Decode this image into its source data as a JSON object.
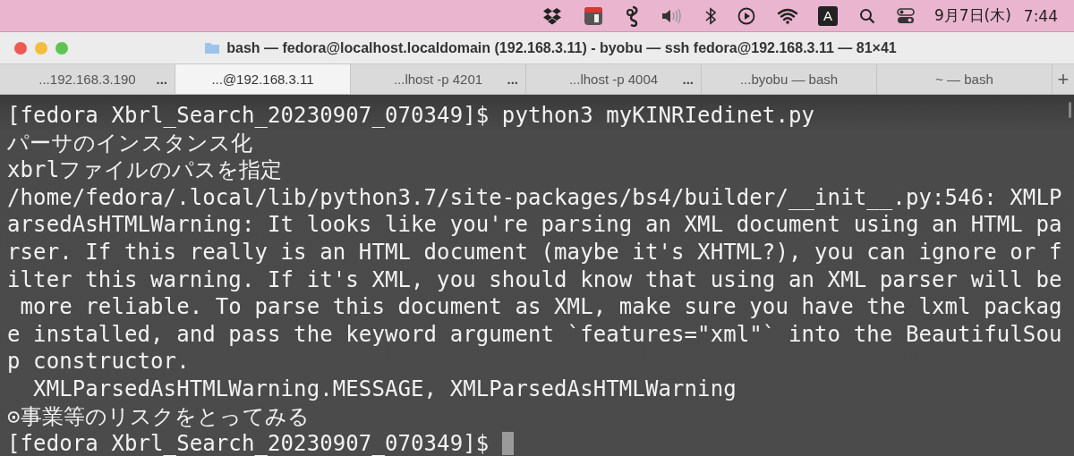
{
  "menu_bar": {
    "input_source": "A",
    "date": "9月7日(木)",
    "time": "7:44"
  },
  "window": {
    "title": "bash — fedora@localhost.localdomain (192.168.3.11) - byobu — ssh fedora@192.168.3.11 — 81×41"
  },
  "tabs": [
    {
      "label": "...192.168.3.190",
      "more": "...",
      "selected": false
    },
    {
      "label": "...@192.168.3.11",
      "selected": true
    },
    {
      "label": "...lhost -p 4201",
      "more": "...",
      "selected": false
    },
    {
      "label": "...lhost -p 4004",
      "more": "...",
      "selected": false
    },
    {
      "label": "...byobu — bash",
      "selected": false
    },
    {
      "label": "~ — bash",
      "selected": false
    }
  ],
  "new_tab": "+",
  "terminal": {
    "lines": [
      "[fedora Xbrl_Search_20230907_070349]$ python3 myKINRIedinet.py",
      "パーサのインスタンス化",
      "xbrlファイルのパスを指定",
      "/home/fedora/.local/lib/python3.7/site-packages/bs4/builder/__init__.py:546: XMLP",
      "arsedAsHTMLWarning: It looks like you're parsing an XML document using an HTML pa",
      "rser. If this really is an HTML document (maybe it's XHTML?), you can ignore or f",
      "ilter this warning. If it's XML, you should know that using an XML parser will be",
      " more reliable. To parse this document as XML, make sure you have the lxml packag",
      "e installed, and pass the keyword argument `features=\"xml\"` into the BeautifulSou",
      "p constructor.",
      "  XMLParsedAsHTMLWarning.MESSAGE, XMLParsedAsHTMLWarning",
      "⊙事業等のリスクをとってみる",
      "[fedora Xbrl_Search_20230907_070349]$ "
    ],
    "cursor_visible": true
  }
}
